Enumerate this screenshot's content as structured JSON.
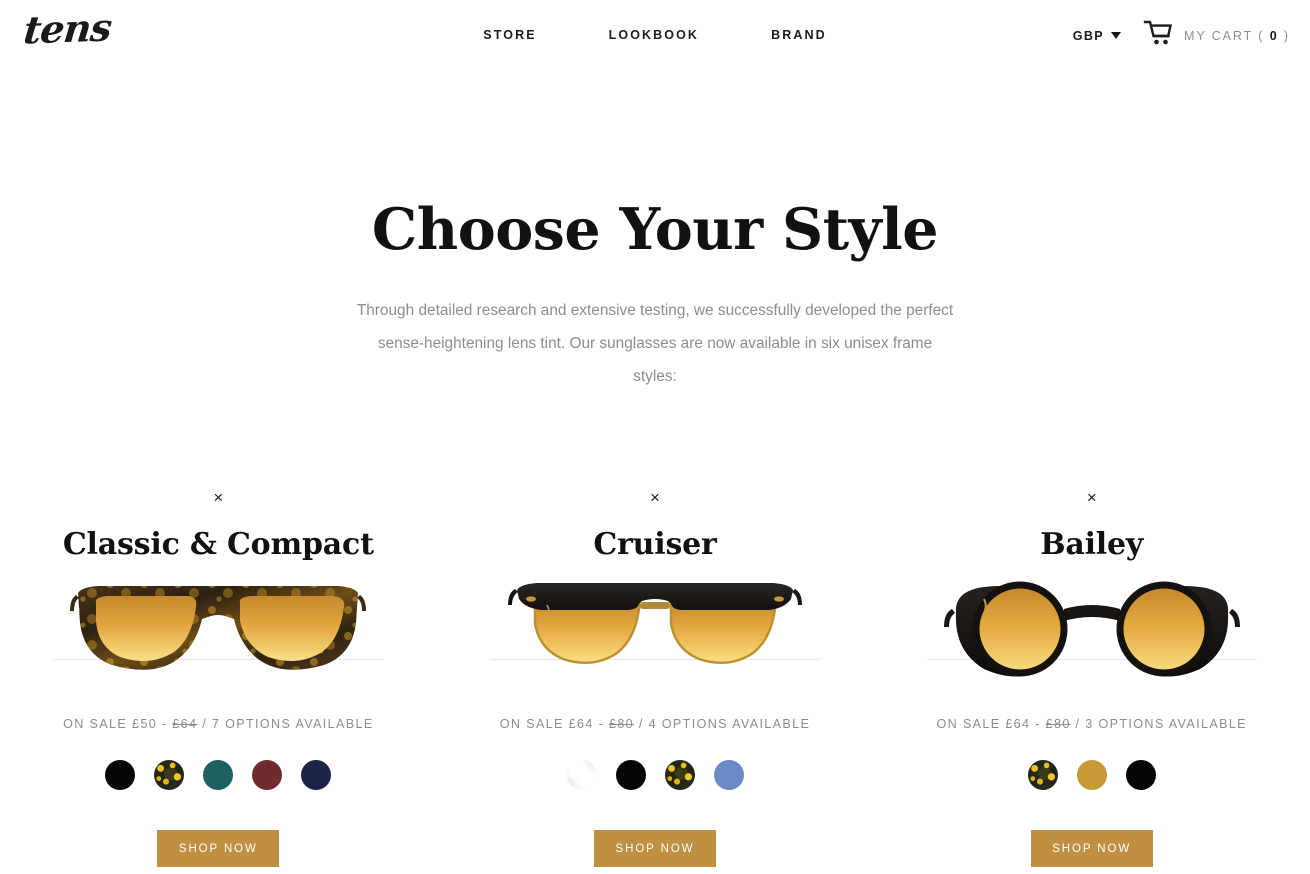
{
  "header": {
    "logo": "tens",
    "nav": [
      {
        "label": "STORE",
        "name": "nav-store"
      },
      {
        "label": "LOOKBOOK",
        "name": "nav-lookbook"
      },
      {
        "label": "BRAND",
        "name": "nav-brand"
      }
    ],
    "currency": {
      "label": "GBP",
      "icon": "chevron-down-icon"
    },
    "cart": {
      "icon": "shopping-cart-icon",
      "label_prefix": "MY CART ( ",
      "count": "0",
      "label_suffix": " )"
    }
  },
  "hero": {
    "title": "Choose Your Style",
    "subtitle": "Through detailed research and extensive testing, we successfully developed the perfect sense-heightening lens tint. Our sunglasses are now available in six unisex frame styles:"
  },
  "products": [
    {
      "close_icon": "×",
      "title": "Classic & Compact",
      "frame_style": "wayfarer",
      "frame_color": "tortoise",
      "price_prefix": "ON SALE £50 - ",
      "price_original": "£64",
      "price_suffix": " / 7 OPTIONS AVAILABLE",
      "sale_price": "£50",
      "original_price": "£64",
      "options_count": "7",
      "swatches": [
        {
          "name": "swatch-black",
          "color": "#050505"
        },
        {
          "name": "swatch-tortoise",
          "color": "tortoise"
        },
        {
          "name": "swatch-teal",
          "color": "#1f5f5f"
        },
        {
          "name": "swatch-maroon",
          "color": "#6e2c2f"
        },
        {
          "name": "swatch-navy",
          "color": "#1b2347"
        }
      ],
      "cta": "SHOP NOW"
    },
    {
      "close_icon": "×",
      "title": "Cruiser",
      "frame_style": "browline",
      "frame_color": "black-gold",
      "price_prefix": "ON SALE £64 - ",
      "price_original": "£80",
      "price_suffix": " / 4 OPTIONS AVAILABLE",
      "sale_price": "£64",
      "original_price": "£80",
      "options_count": "4",
      "swatches": [
        {
          "name": "swatch-marble",
          "color": "marble"
        },
        {
          "name": "swatch-black",
          "color": "#050505"
        },
        {
          "name": "swatch-tortoise",
          "color": "tortoise"
        },
        {
          "name": "swatch-blue",
          "color": "#6a8ac8"
        }
      ],
      "cta": "SHOP NOW"
    },
    {
      "close_icon": "×",
      "title": "Bailey",
      "frame_style": "round",
      "frame_color": "black",
      "price_prefix": "ON SALE £64 - ",
      "price_original": "£80",
      "price_suffix": " / 3 OPTIONS AVAILABLE",
      "sale_price": "£64",
      "original_price": "£80",
      "options_count": "3",
      "swatches": [
        {
          "name": "swatch-tortoise",
          "color": "tortoise"
        },
        {
          "name": "swatch-gold",
          "color": "#c79a35"
        },
        {
          "name": "swatch-black",
          "color": "#050505"
        }
      ],
      "cta": "SHOP NOW"
    }
  ],
  "theme": {
    "accent": "#bf9042",
    "text_dark": "#111111",
    "text_muted": "#8d8d8d",
    "background": "#ffffff",
    "lens_top": "#c98b2e",
    "lens_bottom": "#fbd978"
  }
}
